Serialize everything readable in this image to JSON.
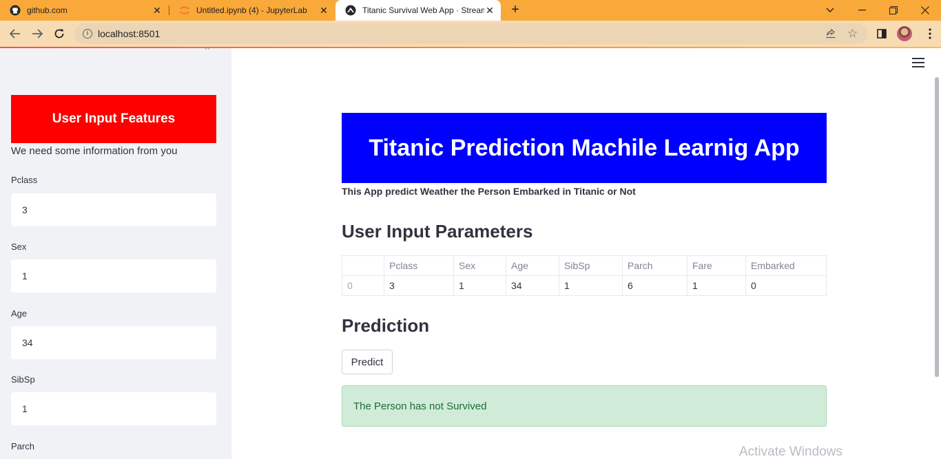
{
  "browser": {
    "tabs": [
      {
        "title": "github.com",
        "active": false,
        "icon": "github-icon"
      },
      {
        "title": "Untitled.ipynb (4) - JupyterLab",
        "active": false,
        "icon": "jupyter-icon"
      },
      {
        "title": "Titanic Survival Web App · Stream",
        "active": true,
        "icon": "streamlit-icon"
      }
    ],
    "url": "localhost:8501"
  },
  "sidebar": {
    "header": "User Input Features",
    "caption": "We need some information from you",
    "fields": [
      {
        "label": "Pclass",
        "value": "3"
      },
      {
        "label": "Sex",
        "value": "1"
      },
      {
        "label": "Age",
        "value": "34"
      },
      {
        "label": "SibSp",
        "value": "1"
      },
      {
        "label": "Parch",
        "value": ""
      }
    ]
  },
  "main": {
    "banner_title": "Titanic Prediction Machile Learnig App",
    "subtitle": "This App predict Weather the Person Embarked in Titanic or Not",
    "params_heading": "User Input Parameters",
    "table": {
      "columns": [
        "",
        "Pclass",
        "Sex",
        "Age",
        "SibSp",
        "Parch",
        "Fare",
        "Embarked"
      ],
      "rows": [
        [
          "0",
          "3",
          "1",
          "34",
          "1",
          "6",
          "1",
          "0"
        ]
      ]
    },
    "prediction_heading": "Prediction",
    "predict_button": "Predict",
    "result": "The Person has not Survived"
  },
  "watermark": "Activate Windows",
  "colors": {
    "tabbar": "#f9a83a",
    "sidebar_header_bg": "#ff0000",
    "banner_bg": "#0000ff",
    "success_bg": "#d0ecd8"
  }
}
